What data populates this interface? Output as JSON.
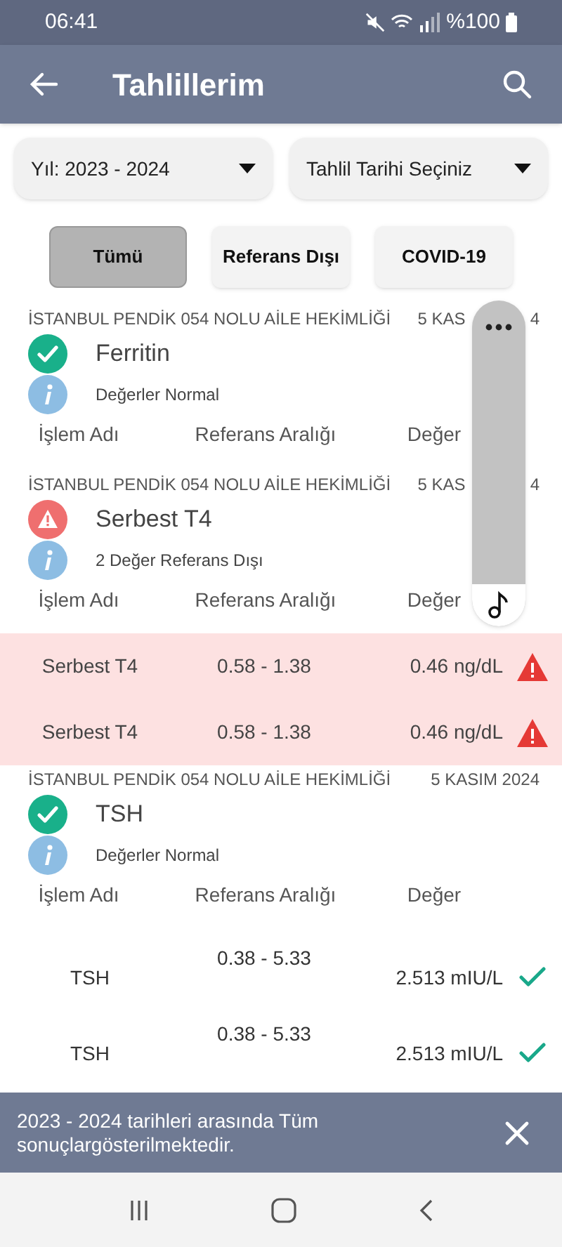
{
  "status_bar": {
    "time": "06:41",
    "battery": "%100"
  },
  "app_bar": {
    "title": "Tahlillerim"
  },
  "filters": [
    {
      "label": "Yıl: 2023 - 2024"
    },
    {
      "label": "Tahlil Tarihi Seçiniz"
    }
  ],
  "chips": [
    {
      "label": "Tümü",
      "selected": true
    },
    {
      "label": "Referans Dışı",
      "selected": false
    },
    {
      "label": "COVID-19",
      "selected": false
    }
  ],
  "cards": [
    {
      "facility": "İSTANBUL PENDİK 054 NOLU AİLE HEKİMLİĞİ",
      "date": "5 KAS",
      "date_tail": "4",
      "kind": "normal",
      "title": "Ferritin",
      "info": "Değerler Normal",
      "columns": [
        "İşlem Adı",
        "Referans Aralığı",
        "Değer"
      ]
    },
    {
      "facility": "İSTANBUL PENDİK 054 NOLU AİLE HEKİMLİĞİ",
      "date": "5 KAS",
      "date_tail": "4",
      "kind": "abnormal",
      "title": "Serbest T4",
      "info": "2 Değer Referans Dışı",
      "columns": [
        "İşlem Adı",
        "Referans Aralığı",
        "Değer"
      ],
      "rows": [
        {
          "name": "Serbest T4",
          "range": "0.58 - 1.38",
          "value": "0.46 ng/dL",
          "flagged": true
        },
        {
          "name": "Serbest T4",
          "range": "0.58 - 1.38",
          "value": "0.46 ng/dL",
          "flagged": true
        }
      ]
    },
    {
      "facility": "İSTANBUL PENDİK 054 NOLU AİLE HEKİMLİĞİ",
      "date": "5 KASIM 2024",
      "kind": "normal",
      "title": "TSH",
      "info": "Değerler Normal",
      "columns": [
        "İşlem Adı",
        "Referans Aralığı",
        "Değer"
      ],
      "rows": [
        {
          "name": "TSH",
          "range": "0.38 - 5.33",
          "value": "2.513 mIU/L",
          "flagged": false
        },
        {
          "name": "TSH",
          "range": "0.38 - 5.33",
          "value": "2.513 mIU/L",
          "flagged": false
        }
      ]
    }
  ],
  "snackbar": {
    "message": "2023 - 2024 tarihleri arasında Tüm sonuçlargösterilmektedir."
  }
}
